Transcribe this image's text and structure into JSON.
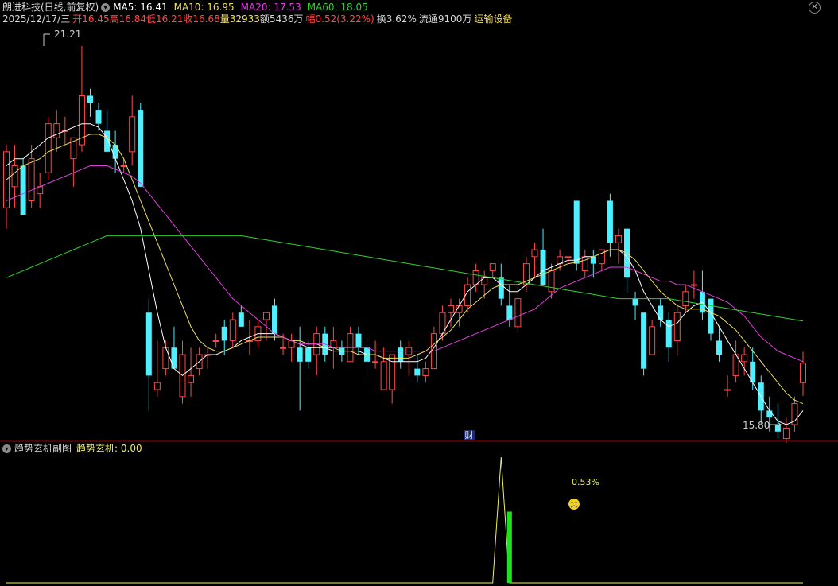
{
  "header": {
    "stock_name": "朗进科技(日线,前复权)",
    "ma5": "MA5: 16.41",
    "ma10": "MA10: 16.95",
    "ma20": "MA20: 17.53",
    "ma60": "MA60: 18.05",
    "date": "2025/12/17/三",
    "open_label": "开",
    "open": "16.45",
    "high_label": "高",
    "high": "16.84",
    "low_label": "低",
    "low": "16.21",
    "close_label": "收",
    "close": "16.68",
    "vol_label": "量",
    "vol": "32933",
    "amt_label": "额",
    "amt": "5436万",
    "chg_label": "幅",
    "chg": "0.52(3.22%)",
    "turnover_label": "换",
    "turnover": "3.62%",
    "float_label": "流通",
    "float": "9100万",
    "industry": "运输设备"
  },
  "annotations": {
    "high_marker": "21.21",
    "low_marker": "15.80",
    "cai_badge": "财"
  },
  "sub": {
    "title": "趋势玄机副图",
    "indicator_name": "趋势玄机",
    "indicator_value": ": 0.00",
    "peak_label": "0.53",
    "peak_suffix": "%"
  },
  "colors": {
    "up": "#ff4a4a",
    "down": "#4ef0ff",
    "ma5": "#ffffff",
    "ma10": "#f0e060",
    "ma20": "#e040e0",
    "ma60": "#30d030",
    "divider": "#a00000",
    "indicator": "#f0f060",
    "signal_bar": "#20e020"
  },
  "chart_data": {
    "type": "candlestick",
    "series_fields": [
      "open",
      "high",
      "low",
      "close"
    ],
    "ylim": [
      15.45,
      21.9
    ],
    "candles": [
      [
        18.9,
        19.8,
        18.6,
        19.7
      ],
      [
        19.2,
        19.8,
        18.9,
        19.5
      ],
      [
        19.5,
        19.6,
        18.8,
        18.8
      ],
      [
        19.0,
        19.8,
        18.9,
        19.6
      ],
      [
        19.1,
        19.4,
        18.9,
        19.2
      ],
      [
        19.4,
        20.2,
        19.3,
        20.1
      ],
      [
        19.9,
        20.3,
        19.7,
        20.1
      ],
      [
        20.0,
        20.2,
        19.8,
        20.0
      ],
      [
        19.6,
        19.9,
        19.2,
        19.9
      ],
      [
        19.8,
        21.21,
        19.7,
        20.5
      ],
      [
        20.5,
        20.6,
        20.2,
        20.4
      ],
      [
        20.3,
        20.4,
        20.0,
        20.1
      ],
      [
        20.0,
        20.3,
        19.7,
        19.7
      ],
      [
        19.8,
        20.0,
        19.4,
        19.6
      ],
      [
        19.5,
        19.6,
        19.4,
        19.5
      ],
      [
        19.7,
        20.5,
        19.5,
        20.2
      ],
      [
        20.3,
        20.4,
        19.2,
        19.2
      ],
      [
        17.4,
        17.6,
        16.0,
        16.5
      ],
      [
        16.3,
        17.0,
        16.2,
        16.4
      ],
      [
        16.6,
        17.0,
        16.5,
        16.9
      ],
      [
        16.9,
        17.2,
        16.7,
        16.6
      ],
      [
        16.2,
        17.0,
        16.1,
        16.8
      ],
      [
        16.4,
        16.9,
        16.2,
        16.5
      ],
      [
        16.6,
        16.9,
        16.5,
        16.8
      ],
      [
        16.8,
        16.9,
        16.6,
        16.8
      ],
      [
        17.0,
        17.1,
        16.9,
        17.0
      ],
      [
        17.2,
        17.3,
        16.8,
        17.0
      ],
      [
        17.0,
        17.4,
        16.9,
        17.3
      ],
      [
        17.4,
        17.5,
        17.2,
        17.2
      ],
      [
        17.0,
        17.3,
        16.8,
        17.0
      ],
      [
        17.0,
        17.3,
        16.9,
        17.2
      ],
      [
        17.3,
        17.4,
        17.0,
        17.4
      ],
      [
        17.5,
        17.6,
        17.0,
        17.1
      ],
      [
        16.9,
        17.1,
        16.8,
        16.9
      ],
      [
        16.9,
        17.1,
        16.7,
        17.0
      ],
      [
        16.9,
        17.2,
        16.0,
        16.7
      ],
      [
        16.9,
        17.0,
        16.6,
        16.7
      ],
      [
        16.8,
        17.2,
        16.5,
        17.1
      ],
      [
        17.1,
        17.2,
        16.7,
        16.8
      ],
      [
        16.9,
        17.2,
        16.6,
        17.0
      ],
      [
        16.9,
        17.0,
        16.7,
        16.8
      ],
      [
        16.7,
        17.2,
        16.7,
        17.1
      ],
      [
        17.1,
        17.2,
        16.8,
        16.9
      ],
      [
        16.9,
        17.0,
        16.5,
        16.7
      ],
      [
        16.7,
        17.0,
        16.6,
        16.7
      ],
      [
        16.3,
        16.9,
        16.3,
        16.7
      ],
      [
        16.3,
        16.8,
        16.1,
        16.8
      ],
      [
        16.9,
        17.0,
        16.6,
        16.7
      ],
      [
        16.8,
        17.0,
        16.5,
        16.9
      ],
      [
        16.6,
        16.8,
        16.4,
        16.5
      ],
      [
        16.5,
        16.7,
        16.4,
        16.6
      ],
      [
        16.6,
        17.2,
        16.6,
        17.1
      ],
      [
        17.1,
        17.5,
        17.0,
        17.4
      ],
      [
        17.4,
        17.6,
        17.2,
        17.5
      ],
      [
        17.4,
        17.6,
        17.2,
        17.5
      ],
      [
        17.5,
        17.9,
        17.4,
        17.8
      ],
      [
        17.8,
        18.1,
        17.7,
        18.0
      ],
      [
        17.8,
        18.0,
        17.6,
        17.9
      ],
      [
        18.0,
        18.1,
        17.9,
        18.1
      ],
      [
        17.9,
        18.1,
        17.5,
        17.6
      ],
      [
        17.5,
        17.8,
        17.2,
        17.3
      ],
      [
        17.2,
        17.8,
        17.1,
        17.6
      ],
      [
        17.8,
        18.2,
        17.7,
        18.1
      ],
      [
        18.2,
        18.4,
        17.9,
        18.3
      ],
      [
        18.3,
        18.6,
        17.8,
        17.8
      ],
      [
        17.7,
        18.1,
        17.6,
        18.0
      ],
      [
        18.1,
        18.3,
        18.0,
        18.2
      ],
      [
        18.2,
        18.2,
        18.1,
        18.2
      ],
      [
        19.0,
        19.0,
        18.0,
        18.1
      ],
      [
        18.0,
        18.3,
        17.9,
        18.2
      ],
      [
        18.2,
        18.3,
        17.9,
        18.1
      ],
      [
        18.1,
        18.3,
        18.0,
        18.3
      ],
      [
        19.0,
        19.1,
        18.2,
        18.4
      ],
      [
        18.4,
        18.6,
        18.1,
        18.5
      ],
      [
        18.6,
        18.6,
        17.7,
        17.9
      ],
      [
        17.6,
        17.7,
        17.3,
        17.5
      ],
      [
        17.4,
        17.4,
        16.5,
        16.6
      ],
      [
        16.8,
        17.3,
        16.8,
        17.2
      ],
      [
        17.5,
        17.6,
        17.2,
        17.3
      ],
      [
        17.3,
        17.4,
        16.7,
        16.9
      ],
      [
        17.0,
        17.5,
        16.8,
        17.4
      ],
      [
        17.5,
        17.8,
        17.4,
        17.7
      ],
      [
        17.8,
        18.0,
        17.6,
        17.8
      ],
      [
        17.7,
        18.0,
        17.3,
        17.4
      ],
      [
        17.6,
        17.6,
        17.0,
        17.1
      ],
      [
        17.0,
        17.2,
        16.7,
        16.8
      ],
      [
        16.3,
        16.5,
        16.2,
        16.3
      ],
      [
        16.5,
        17.0,
        16.4,
        16.8
      ],
      [
        16.7,
        16.9,
        16.5,
        16.8
      ],
      [
        16.7,
        16.9,
        16.3,
        16.4
      ],
      [
        16.4,
        16.5,
        15.8,
        16.0
      ],
      [
        16.0,
        16.2,
        15.7,
        15.9
      ],
      [
        15.8,
        16.1,
        15.6,
        15.7
      ],
      [
        15.6,
        15.9,
        15.5,
        15.75
      ],
      [
        15.8,
        16.2,
        15.7,
        16.1
      ],
      [
        16.4,
        16.84,
        16.21,
        16.68
      ]
    ],
    "ma_series": [
      {
        "name": "MA5",
        "values": [
          19.5,
          19.6,
          19.6,
          19.7,
          19.8,
          19.9,
          19.95,
          20.0,
          20.05,
          20.1,
          20.1,
          20.05,
          19.9,
          19.6,
          19.3,
          19.0,
          18.6,
          18.0,
          17.4,
          16.9,
          16.6,
          16.5,
          16.6,
          16.7,
          16.8,
          16.8,
          16.85,
          16.9,
          17.0,
          17.05,
          17.1,
          17.1,
          17.1,
          17.05,
          17.0,
          16.95,
          16.9,
          16.9,
          16.9,
          16.85,
          16.85,
          16.85,
          16.85,
          16.8,
          16.8,
          16.75,
          16.7,
          16.7,
          16.7,
          16.7,
          16.75,
          16.9,
          17.1,
          17.3,
          17.5,
          17.7,
          17.8,
          17.9,
          17.9,
          17.8,
          17.7,
          17.7,
          17.8,
          17.9,
          18.0,
          18.05,
          18.1,
          18.15,
          18.15,
          18.2,
          18.2,
          18.25,
          18.3,
          18.3,
          18.2,
          18.0,
          17.7,
          17.5,
          17.3,
          17.2,
          17.25,
          17.4,
          17.5,
          17.55,
          17.4,
          17.2,
          17.0,
          16.8,
          16.6,
          16.4,
          16.2,
          16.0,
          15.85,
          15.8,
          15.85,
          16.0
        ]
      },
      {
        "name": "MA10",
        "values": [
          19.3,
          19.4,
          19.5,
          19.55,
          19.6,
          19.7,
          19.75,
          19.8,
          19.85,
          19.9,
          19.95,
          19.95,
          19.9,
          19.8,
          19.6,
          19.3,
          19.0,
          18.7,
          18.4,
          18.1,
          17.8,
          17.5,
          17.2,
          17.0,
          16.9,
          16.85,
          16.85,
          16.9,
          16.95,
          17.0,
          17.05,
          17.05,
          17.05,
          17.05,
          17.0,
          17.0,
          16.95,
          16.95,
          16.9,
          16.9,
          16.85,
          16.85,
          16.8,
          16.8,
          16.8,
          16.75,
          16.75,
          16.75,
          16.75,
          16.8,
          16.85,
          16.95,
          17.05,
          17.15,
          17.3,
          17.45,
          17.55,
          17.65,
          17.75,
          17.8,
          17.8,
          17.8,
          17.85,
          17.9,
          17.95,
          18.0,
          18.05,
          18.1,
          18.12,
          18.15,
          18.2,
          18.25,
          18.3,
          18.3,
          18.25,
          18.15,
          18.0,
          17.85,
          17.7,
          17.6,
          17.5,
          17.45,
          17.45,
          17.45,
          17.4,
          17.35,
          17.25,
          17.15,
          17.0,
          16.85,
          16.7,
          16.55,
          16.4,
          16.25,
          16.15,
          16.1
        ]
      },
      {
        "name": "MA20",
        "values": [
          19.0,
          19.05,
          19.1,
          19.15,
          19.2,
          19.25,
          19.3,
          19.35,
          19.4,
          19.45,
          19.5,
          19.5,
          19.5,
          19.45,
          19.4,
          19.35,
          19.25,
          19.1,
          18.95,
          18.8,
          18.65,
          18.5,
          18.35,
          18.2,
          18.05,
          17.9,
          17.75,
          17.6,
          17.5,
          17.4,
          17.3,
          17.2,
          17.1,
          17.05,
          17.0,
          16.95,
          16.95,
          16.95,
          16.95,
          16.9,
          16.9,
          16.9,
          16.9,
          16.9,
          16.85,
          16.85,
          16.85,
          16.85,
          16.85,
          16.85,
          16.85,
          16.85,
          16.9,
          16.95,
          17.0,
          17.05,
          17.1,
          17.15,
          17.2,
          17.25,
          17.3,
          17.35,
          17.4,
          17.45,
          17.55,
          17.65,
          17.75,
          17.8,
          17.85,
          17.9,
          17.95,
          18.0,
          18.05,
          18.05,
          18.05,
          18.0,
          17.95,
          17.9,
          17.85,
          17.85,
          17.8,
          17.8,
          17.75,
          17.7,
          17.65,
          17.6,
          17.55,
          17.45,
          17.35,
          17.2,
          17.05,
          16.95,
          16.85,
          16.8,
          16.75,
          16.7
        ]
      },
      {
        "name": "MA60",
        "values": [
          17.9,
          17.95,
          18.0,
          18.05,
          18.1,
          18.15,
          18.2,
          18.25,
          18.3,
          18.35,
          18.4,
          18.45,
          18.5,
          18.5,
          18.5,
          18.5,
          18.5,
          18.5,
          18.5,
          18.5,
          18.5,
          18.5,
          18.5,
          18.5,
          18.5,
          18.5,
          18.5,
          18.5,
          18.5,
          18.48,
          18.46,
          18.44,
          18.42,
          18.4,
          18.38,
          18.36,
          18.34,
          18.32,
          18.3,
          18.28,
          18.26,
          18.24,
          18.22,
          18.2,
          18.18,
          18.16,
          18.14,
          18.12,
          18.1,
          18.08,
          18.06,
          18.04,
          18.02,
          18.0,
          17.98,
          17.96,
          17.94,
          17.92,
          17.9,
          17.88,
          17.86,
          17.84,
          17.82,
          17.8,
          17.78,
          17.76,
          17.74,
          17.72,
          17.7,
          17.68,
          17.66,
          17.64,
          17.62,
          17.6,
          17.6,
          17.6,
          17.6,
          17.6,
          17.6,
          17.6,
          17.58,
          17.56,
          17.54,
          17.52,
          17.5,
          17.48,
          17.46,
          17.44,
          17.42,
          17.4,
          17.38,
          17.36,
          17.34,
          17.32,
          17.3,
          17.28
        ]
      }
    ],
    "indicator": {
      "name": "趋势玄机",
      "ylim": [
        0,
        0.6
      ],
      "values": [
        0,
        0,
        0,
        0,
        0,
        0,
        0,
        0,
        0,
        0,
        0,
        0,
        0,
        0,
        0,
        0,
        0,
        0,
        0,
        0,
        0,
        0,
        0,
        0,
        0,
        0,
        0,
        0,
        0,
        0,
        0,
        0,
        0,
        0,
        0,
        0,
        0,
        0,
        0,
        0,
        0,
        0,
        0,
        0,
        0,
        0,
        0,
        0,
        0,
        0,
        0,
        0,
        0,
        0,
        0,
        0,
        0,
        0,
        0,
        0,
        0,
        0,
        0,
        0,
        0,
        0,
        0,
        0,
        0,
        0,
        0,
        0,
        0,
        0,
        0,
        0,
        0,
        0,
        0,
        0,
        0,
        0,
        0,
        0,
        0,
        0,
        0,
        0,
        0,
        0,
        0,
        0,
        0,
        0,
        0,
        0
      ],
      "peak_index": 59,
      "peak_value": 0.6,
      "signal_bar_index": 60,
      "signal_bar_value": 0.34
    }
  }
}
